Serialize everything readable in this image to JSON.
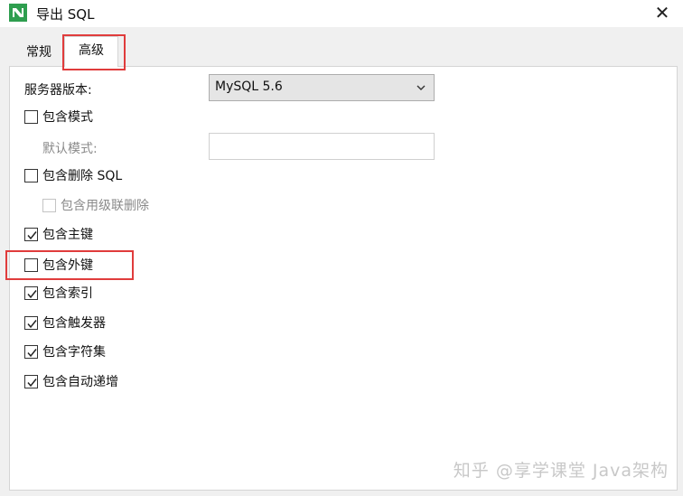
{
  "window": {
    "title": "导出 SQL",
    "close_glyph": "✕",
    "icon": "navicat-icon"
  },
  "tabs": [
    {
      "label": "常规",
      "selected": false
    },
    {
      "label": "高级",
      "selected": true
    }
  ],
  "advanced": {
    "server_version_label": "服务器版本:",
    "server_version_value": "MySQL 5.6",
    "default_schema_label": "默认模式:",
    "default_schema_value": "",
    "options": [
      {
        "label": "包含模式",
        "checked": false,
        "enabled": true
      },
      {
        "label": "包含删除 SQL",
        "checked": false,
        "enabled": true
      },
      {
        "label": "包含用级联删除",
        "checked": false,
        "enabled": false
      },
      {
        "label": "包含主键",
        "checked": true,
        "enabled": true
      },
      {
        "label": "包含外键",
        "checked": false,
        "enabled": true
      },
      {
        "label": "包含索引",
        "checked": true,
        "enabled": true
      },
      {
        "label": "包含触发器",
        "checked": true,
        "enabled": true
      },
      {
        "label": "包含字符集",
        "checked": true,
        "enabled": true
      },
      {
        "label": "包含自动递增",
        "checked": true,
        "enabled": true
      }
    ]
  },
  "watermark": "知乎 @享学课堂 Java架构",
  "colors": {
    "highlight": "#e03c3c",
    "dialog_bg": "#f0f0f0",
    "panel_bg": "#ffffff",
    "icon_green": "#2e9e4f"
  }
}
